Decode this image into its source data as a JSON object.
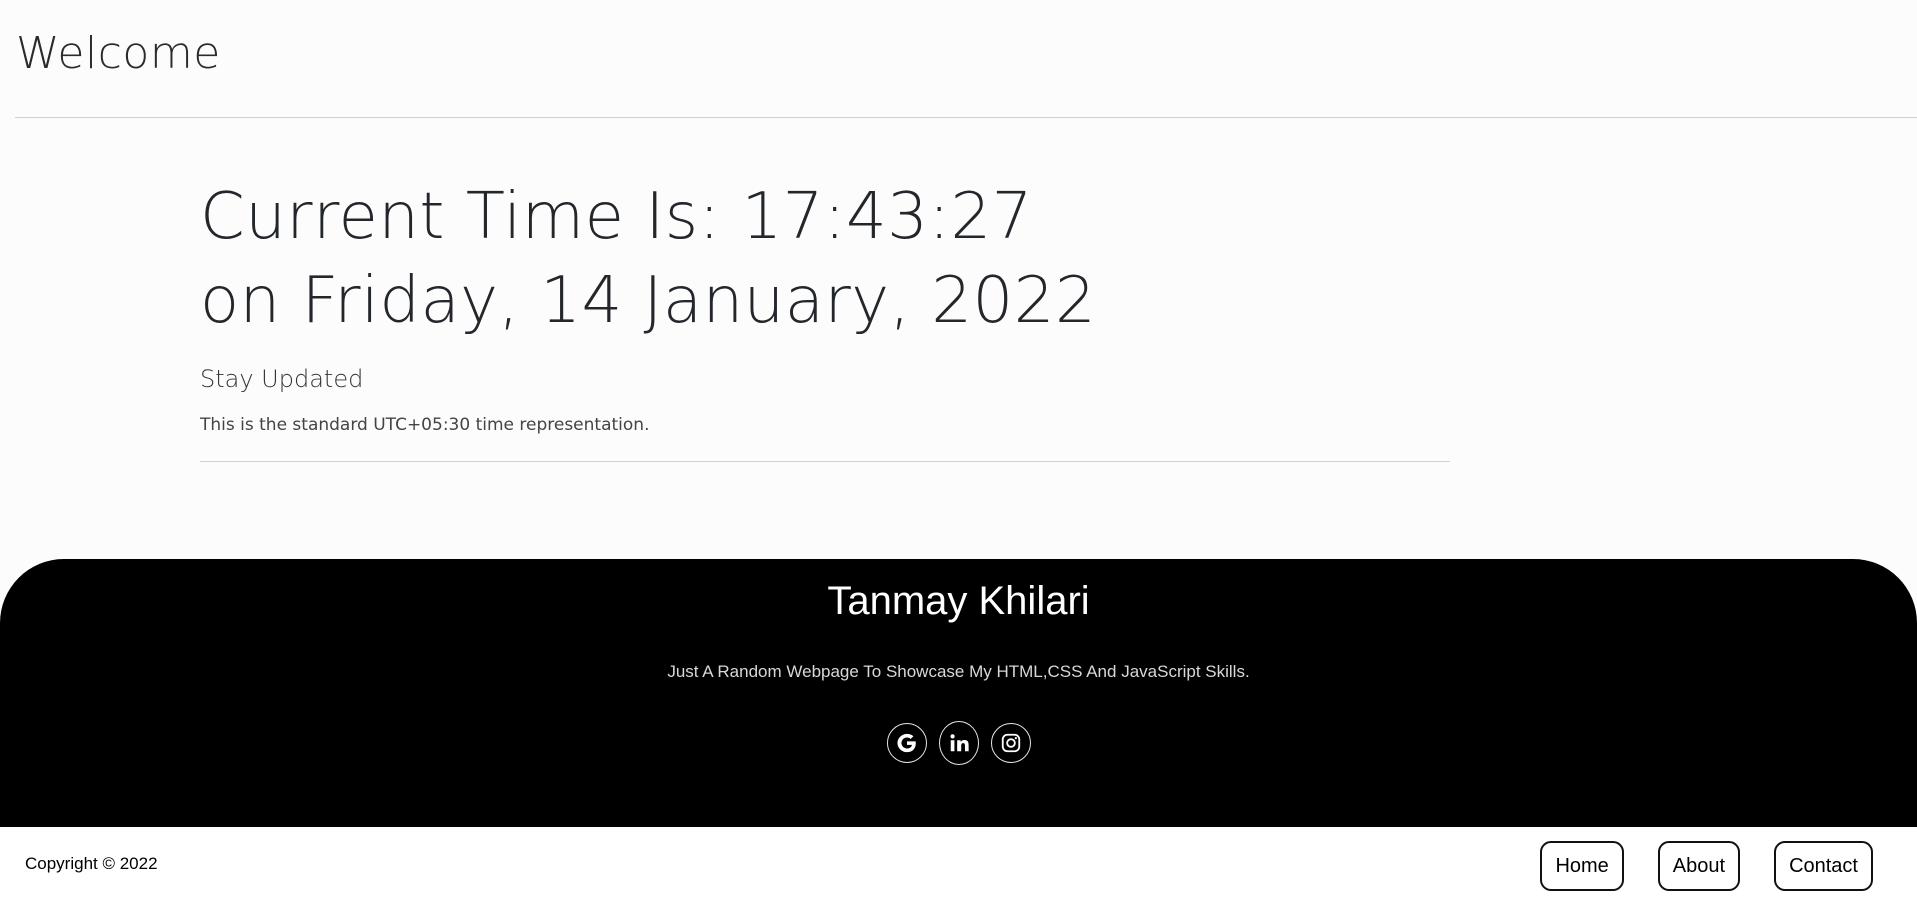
{
  "header": {
    "title": "Welcome"
  },
  "main": {
    "time_line": "Current Time Is: 17:43:27",
    "date_line": "on Friday, 14 January, 2022",
    "subtitle": "Stay Updated",
    "description": "This is the standard UTC+05:30 time representation."
  },
  "footer": {
    "name": "Tanmay Khilari",
    "tagline": "Just A Random Webpage To Showcase My HTML,CSS And JavaScript Skills.",
    "social": [
      {
        "icon": "google-icon"
      },
      {
        "icon": "linkedin-icon"
      },
      {
        "icon": "instagram-icon"
      }
    ]
  },
  "bottom_bar": {
    "copyright": "Copyright © 2022",
    "nav": {
      "home": "Home",
      "about": "About",
      "contact": "Contact"
    }
  }
}
